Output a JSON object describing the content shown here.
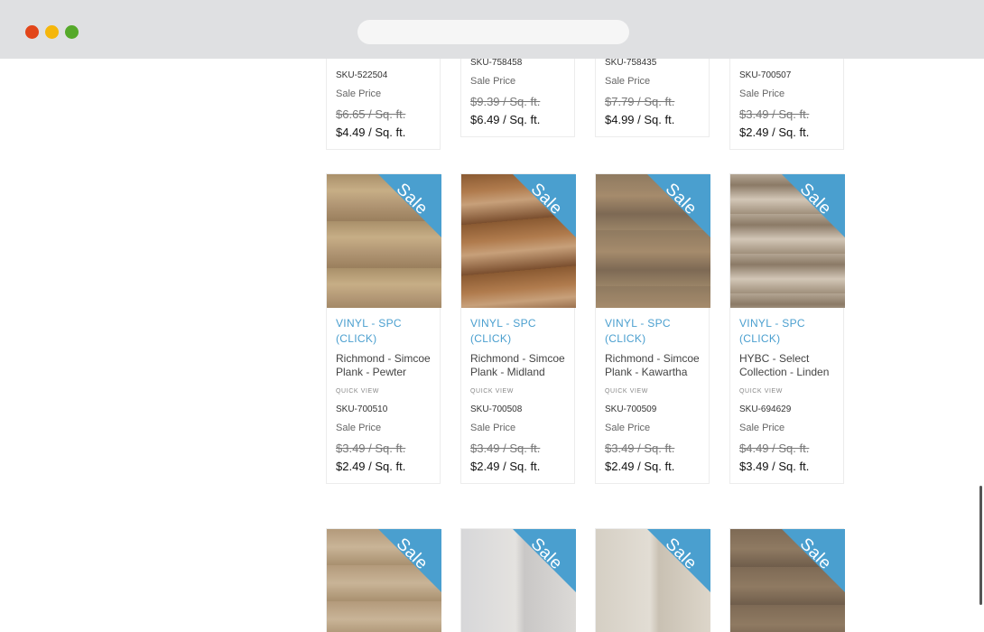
{
  "browser": {
    "url": ""
  },
  "ribbon_label": "Sale",
  "row_top": [
    {
      "sku": "SKU-522504",
      "sale_label": "Sale Price",
      "old_price": "$6.65 / Sq. ft.",
      "new_price": "$4.49 / Sq. ft."
    },
    {
      "sku": "SKU-758458",
      "sale_label": "Sale Price",
      "old_price": "$9.39 / Sq. ft.",
      "new_price": "$6.49 / Sq. ft."
    },
    {
      "sku": "SKU-758435",
      "sale_label": "Sale Price",
      "old_price": "$7.79 / Sq. ft.",
      "new_price": "$4.99 / Sq. ft."
    },
    {
      "sku": "SKU-700507",
      "sale_label": "Sale Price",
      "old_price": "$3.49 / Sq. ft.",
      "new_price": "$2.49 / Sq. ft."
    }
  ],
  "row_middle": [
    {
      "category": "VINYL - SPC (CLICK)",
      "name": "Richmond - Simcoe Plank - Pewter",
      "quick_view": "QUICK VIEW",
      "sku": "SKU-700510",
      "sale_label": "Sale Price",
      "old_price": "$3.49 / Sq. ft.",
      "new_price": "$2.49 / Sq. ft."
    },
    {
      "category": "VINYL - SPC (CLICK)",
      "name": "Richmond - Simcoe Plank - Midland",
      "quick_view": "QUICK VIEW",
      "sku": "SKU-700508",
      "sale_label": "Sale Price",
      "old_price": "$3.49 / Sq. ft.",
      "new_price": "$2.49 / Sq. ft."
    },
    {
      "category": "VINYL - SPC (CLICK)",
      "name": "Richmond - Simcoe Plank - Kawartha",
      "quick_view": "QUICK VIEW",
      "sku": "SKU-700509",
      "sale_label": "Sale Price",
      "old_price": "$3.49 / Sq. ft.",
      "new_price": "$2.49 / Sq. ft."
    },
    {
      "category": "VINYL - SPC (CLICK)",
      "name": "HYBC - Select Collection - Linden",
      "quick_view": "QUICK VIEW",
      "sku": "SKU-694629",
      "sale_label": "Sale Price",
      "old_price": "$4.49 / Sq. ft.",
      "new_price": "$3.49 / Sq. ft."
    }
  ],
  "colors": {
    "accent": "#4a9fcf",
    "chrome": "#dfe0e2"
  }
}
